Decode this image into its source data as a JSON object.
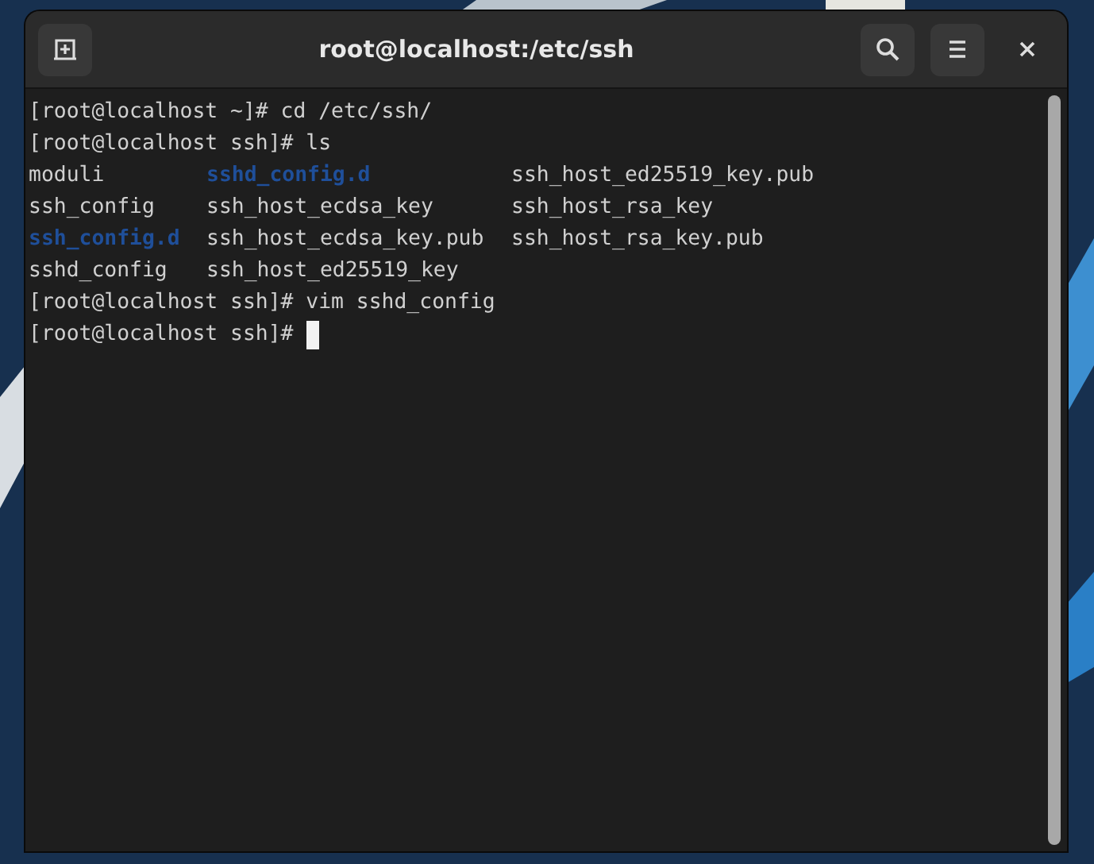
{
  "window": {
    "title": "root@localhost:/etc/ssh"
  },
  "terminal": {
    "lines": [
      {
        "kind": "text",
        "text": "[root@localhost ~]# cd /etc/ssh/",
        "cursor": false
      },
      {
        "kind": "text",
        "text": "[root@localhost ssh]# ls",
        "cursor": false
      },
      {
        "kind": "listing",
        "rows": [
          [
            {
              "name": "moduli",
              "directory": false
            },
            {
              "name": "sshd_config.d",
              "directory": true
            },
            {
              "name": "ssh_host_ed25519_key.pub",
              "directory": false
            }
          ],
          [
            {
              "name": "ssh_config",
              "directory": false
            },
            {
              "name": "ssh_host_ecdsa_key",
              "directory": false
            },
            {
              "name": "ssh_host_rsa_key",
              "directory": false
            }
          ],
          [
            {
              "name": "ssh_config.d",
              "directory": true
            },
            {
              "name": "ssh_host_ecdsa_key.pub",
              "directory": false
            },
            {
              "name": "ssh_host_rsa_key.pub",
              "directory": false
            }
          ],
          [
            {
              "name": "sshd_config",
              "directory": false
            },
            {
              "name": "ssh_host_ed25519_key",
              "directory": false
            }
          ]
        ]
      },
      {
        "kind": "text",
        "text": "[root@localhost ssh]# vim sshd_config",
        "cursor": false
      },
      {
        "kind": "text",
        "text": "[root@localhost ssh]#",
        "cursor": true
      }
    ]
  }
}
